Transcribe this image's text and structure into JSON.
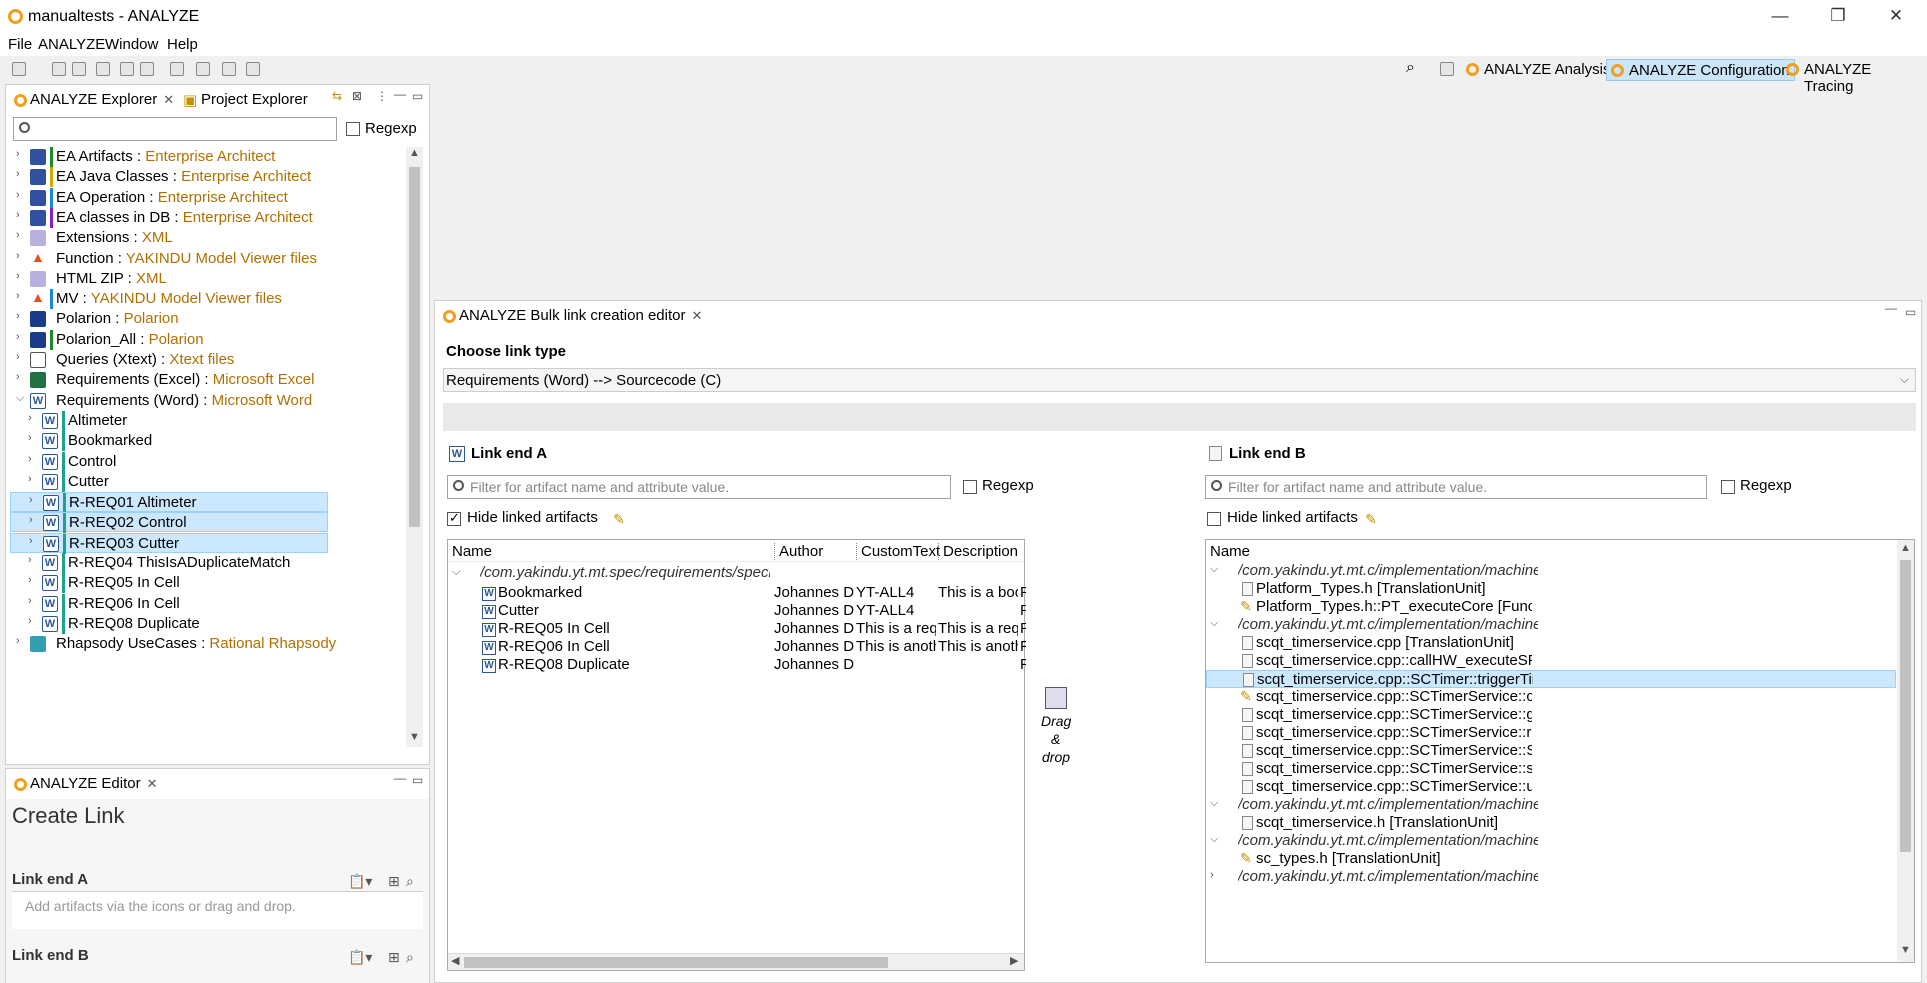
{
  "window": {
    "title": "manualtests - ANALYZE"
  },
  "menu": [
    "File",
    "ANALYZE",
    "Window",
    "Help"
  ],
  "perspectives": [
    "ANALYZE Analysis",
    "ANALYZE Configuration",
    "ANALYZE Tracing"
  ],
  "explorer": {
    "tabs": [
      "ANALYZE Explorer",
      "Project Explorer"
    ],
    "regexp_label": "Regexp",
    "items": [
      {
        "name": "EA Artifacts",
        "type": "Enterprise Architect",
        "icon": "ea-icon",
        "bar": "#1e8a2a"
      },
      {
        "name": "EA Java Classes",
        "type": "Enterprise Architect",
        "icon": "ea-icon",
        "bar": "#d4a800"
      },
      {
        "name": "EA Operation",
        "type": "Enterprise Architect",
        "icon": "ea-icon",
        "bar": "#1a8ad4"
      },
      {
        "name": "EA classes in DB",
        "type": "Enterprise Architect",
        "icon": "ea-icon",
        "bar": "#8a20c0"
      },
      {
        "name": "Extensions",
        "type": "XML",
        "icon": "xml-icon",
        "bar": ""
      },
      {
        "name": "Function",
        "type": "YAKINDU Model Viewer files",
        "icon": "yakindu-icon",
        "bar": ""
      },
      {
        "name": "HTML ZIP",
        "type": "XML",
        "icon": "xml-icon",
        "bar": ""
      },
      {
        "name": "MV",
        "type": "YAKINDU Model Viewer files",
        "icon": "yakindu-icon",
        "bar": "#1a8ad4"
      },
      {
        "name": "Polarion",
        "type": "Polarion",
        "icon": "polarion-icon",
        "bar": ""
      },
      {
        "name": "Polarion_All",
        "type": "Polarion",
        "icon": "polarion-icon",
        "bar": "#1e8a2a"
      },
      {
        "name": "Queries (Xtext)",
        "type": "Xtext files",
        "icon": "xtext-icon",
        "bar": ""
      },
      {
        "name": "Requirements (Excel)",
        "type": "Microsoft Excel",
        "icon": "excel-icon",
        "bar": ""
      },
      {
        "name": "Requirements (Word)",
        "type": "Microsoft Word",
        "icon": "word-icon",
        "bar": "",
        "expanded": true
      }
    ],
    "children": [
      {
        "name": "Altimeter",
        "selected": false
      },
      {
        "name": "Bookmarked",
        "selected": false
      },
      {
        "name": "Control",
        "selected": false
      },
      {
        "name": "Cutter",
        "selected": false
      },
      {
        "name": "R-REQ01 Altimeter",
        "selected": true
      },
      {
        "name": "R-REQ02 Control",
        "selected": true
      },
      {
        "name": "R-REQ03 Cutter",
        "selected": true
      },
      {
        "name": "R-REQ04 ThisIsADuplicateMatch",
        "selected": false
      },
      {
        "name": "R-REQ05 In Cell",
        "selected": false
      },
      {
        "name": "R-REQ06 In Cell",
        "selected": false
      },
      {
        "name": "R-REQ08 Duplicate",
        "selected": false
      }
    ],
    "cut_item": {
      "name": "Rhapsody UseCases",
      "type": "Rational Rhapsody"
    }
  },
  "editor_panel": {
    "tab": "ANALYZE Editor",
    "title": "Create Link",
    "end_a_label": "Link end A",
    "end_b_label": "Link end B",
    "placeholder": "Add artifacts via the icons or drag and drop."
  },
  "bulk": {
    "tab": "ANALYZE Bulk link creation editor",
    "choose_label": "Choose link type",
    "link_type": "Requirements (Word) --> Sourcecode (C)",
    "end_a": {
      "title": "Link end A",
      "filter_placeholder": "Filter for artifact name and attribute value.",
      "regexp": "Regexp",
      "hide_linked": "Hide linked artifacts",
      "columns": [
        "Name",
        "Author",
        "CustomText",
        "Description"
      ],
      "group": "/com.yakindu.yt.mt.spec/requirements/specification.doc",
      "rows": [
        {
          "name": "Bookmarked",
          "author": "Johannes Di...",
          "custom": "YT-ALL4",
          "desc": "This is a boo...",
          "extra": "F"
        },
        {
          "name": "Cutter",
          "author": "Johannes Di...",
          "custom": "YT-ALL4",
          "desc": "",
          "extra": "F"
        },
        {
          "name": "R-REQ05 In Cell",
          "author": "Johannes Di...",
          "custom": "This is a req...",
          "desc": "This is a req...",
          "extra": "F"
        },
        {
          "name": "R-REQ06 In Cell",
          "author": "Johannes Di...",
          "custom": "This is anoth...",
          "desc": "This is anoth...",
          "extra": "F"
        },
        {
          "name": "R-REQ08 Duplicate",
          "author": "Johannes Di...",
          "custom": "",
          "desc": "",
          "extra": "F"
        }
      ]
    },
    "drag_drop": [
      "Drag",
      "&",
      "drop"
    ],
    "end_b": {
      "title": "Link end B",
      "filter_placeholder": "Filter for artifact name and attribute value.",
      "regexp": "Regexp",
      "hide_linked": "Hide linked artifacts",
      "column": "Name",
      "rows": [
        {
          "kind": "group",
          "text": "/com.yakindu.yt.mt.c/implementation/machine/Platfor",
          "arrow": "v"
        },
        {
          "kind": "item",
          "text": "Platform_Types.h [TranslationUnit]",
          "icon": "cpp"
        },
        {
          "kind": "item",
          "text": "Platform_Types.h::PT_executeCore [FunctionDeclara",
          "icon": "pen"
        },
        {
          "kind": "group",
          "text": "/com.yakindu.yt.mt.c/implementation/machine/scqt_tir",
          "arrow": "v"
        },
        {
          "kind": "item",
          "text": "scqt_timerservice.cpp [TranslationUnit]",
          "icon": "cpp"
        },
        {
          "kind": "item",
          "text": "scqt_timerservice.cpp::callHW_executeSPI [Function",
          "icon": "cpp"
        },
        {
          "kind": "item",
          "text": "scqt_timerservice.cpp::SCTimer::triggerTimeEvent [F",
          "icon": "cpp",
          "selected": true
        },
        {
          "kind": "item",
          "text": "scqt_timerservice.cpp::SCTimerService::cancel [Func",
          "icon": "pen"
        },
        {
          "kind": "item",
          "text": "scqt_timerservice.cpp::SCTimerService::getTimer [Fu",
          "icon": "cpp"
        },
        {
          "kind": "item",
          "text": "scqt_timerservice.cpp::SCTimerService::raiseTimeEve",
          "icon": "cpp"
        },
        {
          "kind": "item",
          "text": "scqt_timerservice.cpp::SCTimerService::SCTimerServ",
          "icon": "cpp"
        },
        {
          "kind": "item",
          "text": "scqt_timerservice.cpp::SCTimerService::setTimer [Fu",
          "icon": "cpp"
        },
        {
          "kind": "item",
          "text": "scqt_timerservice.cpp::SCTimerService::unsetTimer [",
          "icon": "cpp"
        },
        {
          "kind": "group",
          "text": "/com.yakindu.yt.mt.c/implementation/machine/scqt_tir",
          "arrow": "v"
        },
        {
          "kind": "item",
          "text": "scqt_timerservice.h [TranslationUnit]",
          "icon": "cpp"
        },
        {
          "kind": "group",
          "text": "/com.yakindu.yt.mt.c/implementation/machine/sc_type",
          "arrow": "v"
        },
        {
          "kind": "item",
          "text": "sc_types.h [TranslationUnit]",
          "icon": "pen"
        },
        {
          "kind": "group",
          "text": "/com.yakindu.yt.mt.c/implementation/machine/Statem",
          "arrow": ">"
        }
      ]
    }
  }
}
